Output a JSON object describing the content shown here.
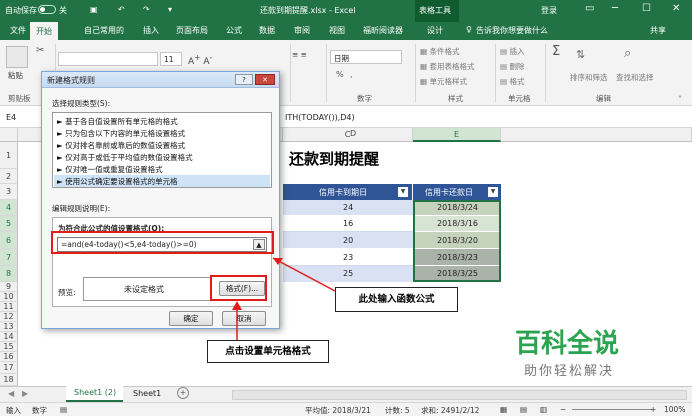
{
  "window": {
    "autosave_label": "自动保存",
    "autosave_state": "关",
    "title": "还款到期提醒.xlsx - Excel",
    "context_tab": "表格工具",
    "login": "登录",
    "colors": {
      "brand": "#217346",
      "accent_red": "#e31b1b"
    }
  },
  "tabs": [
    "文件",
    "开始",
    "自己常用的",
    "插入",
    "页面布局",
    "公式",
    "数据",
    "审阅",
    "视图",
    "福昕阅读器",
    "设计"
  ],
  "tell_me": "告诉我你想要做什么",
  "share": "共享",
  "ribbon": {
    "paste": "粘贴",
    "clipboard_group": "剪贴板",
    "font_size": "11",
    "number_format": "日期",
    "number_group": "数字",
    "percent_symbol": "%",
    "comma_symbol": ",",
    "cond_fmt": "条件格式",
    "table_fmt": "套用表格格式",
    "cell_style": "单元格样式",
    "style_group": "样式",
    "insert": "插入",
    "delete": "删除",
    "format": "格式",
    "cells_group": "单元格",
    "sort_filter": "排序和筛选",
    "find_select": "查找和选择",
    "editing_group": "编辑"
  },
  "formula_bar": {
    "name_box": "E4",
    "formula_tail": "ITH(TODAY()),D4)"
  },
  "sheet": {
    "title": "还款到期提醒",
    "headers": [
      "信用卡到期日",
      "信用卡还款日"
    ],
    "rows": [
      {
        "due": "24",
        "pay": "2018/3/24"
      },
      {
        "due": "16",
        "pay": "2018/3/16"
      },
      {
        "due": "20",
        "pay": "2018/3/20"
      },
      {
        "due": "23",
        "pay": "2018/3/23"
      },
      {
        "due": "25",
        "pay": "2018/3/25"
      }
    ],
    "columns": [
      "C",
      "D",
      "E"
    ],
    "row_numbers": [
      "1",
      "2",
      "3",
      "4",
      "5",
      "6",
      "7",
      "8",
      "9",
      "10",
      "11",
      "12",
      "13",
      "14",
      "15",
      "16",
      "17",
      "18"
    ]
  },
  "sheets": {
    "tabs": [
      "Sheet1 (2)",
      "Sheet1"
    ],
    "add": "+"
  },
  "status": {
    "mode": "输入",
    "numeric": "数字",
    "average": "平均值: 2018/3/21",
    "count": "计数: 5",
    "sum": "求和: 2491/2/12",
    "zoom": "100%"
  },
  "dialog": {
    "title": "新建格式规则",
    "help": "?",
    "rule_type_label": "选择规则类型(S):",
    "rules": [
      "► 基于各自值设置所有单元格的格式",
      "► 只为包含以下内容的单元格设置格式",
      "► 仅对排名靠前或靠后的数值设置格式",
      "► 仅对高于或低于平均值的数值设置格式",
      "► 仅对唯一值或重复值设置格式",
      "► 使用公式确定要设置格式的单元格"
    ],
    "edit_label": "编辑规则说明(E):",
    "formula_label": "为符合此公式的值设置格式(O):",
    "formula": "=and(e4-today()<5,e4-today()>=0)",
    "preview_label": "预览:",
    "preview_text": "未设定格式",
    "format_button": "格式(F)...",
    "ok": "确定",
    "cancel": "取消"
  },
  "callouts": {
    "formula_note": "此处输入函数公式",
    "format_note": "点击设置单元格格式"
  },
  "watermark": {
    "main": "百科全说",
    "sub": "助你轻松解决"
  }
}
